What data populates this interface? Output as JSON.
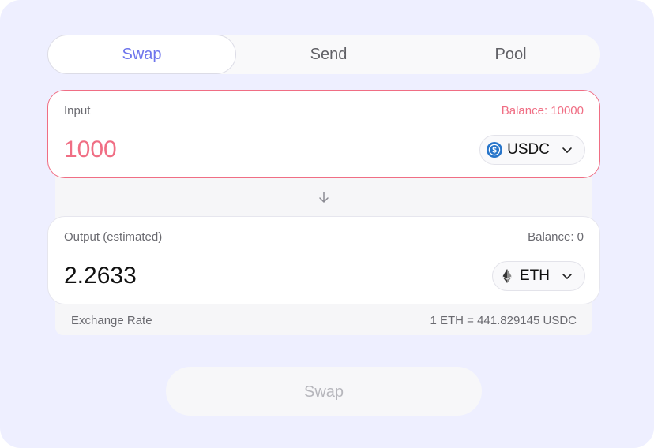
{
  "tabs": [
    {
      "label": "Swap",
      "active": true
    },
    {
      "label": "Send",
      "active": false
    },
    {
      "label": "Pool",
      "active": false
    }
  ],
  "input": {
    "label": "Input",
    "balance": "Balance: 10000",
    "amount": "1000",
    "token": {
      "symbol": "USDC",
      "icon": "usdc-icon"
    }
  },
  "output": {
    "label": "Output (estimated)",
    "balance": "Balance: 0",
    "amount": "2.2633",
    "token": {
      "symbol": "ETH",
      "icon": "eth-icon"
    }
  },
  "exchange_rate": {
    "label": "Exchange Rate",
    "value": "1 ETH = 441.829145 USDC"
  },
  "swap_button": {
    "label": "Swap"
  },
  "colors": {
    "background": "#eeefff",
    "accent": "#6e75ec",
    "error": "#f06e84",
    "usdc": "#2775ca"
  }
}
